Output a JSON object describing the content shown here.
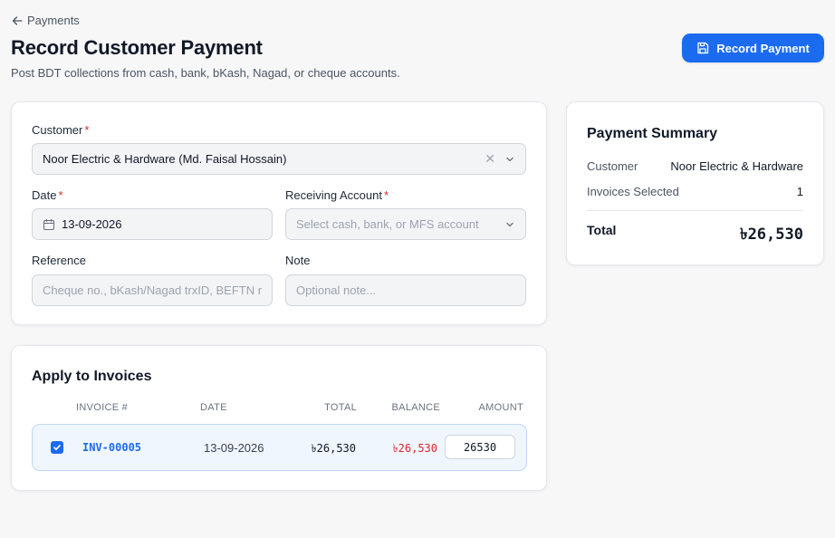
{
  "header": {
    "back_label": "Payments",
    "title": "Record Customer Payment",
    "subtitle": "Post BDT collections from cash, bank, bKash, Nagad, or cheque accounts.",
    "primary_button_label": "Record Payment"
  },
  "form": {
    "customer_label": "Customer",
    "customer_value": "Noor Electric & Hardware (Md. Faisal Hossain)",
    "date_label": "Date",
    "date_value": "13-09-2026",
    "account_label": "Receiving Account",
    "account_placeholder": "Select cash, bank, or MFS account",
    "reference_label": "Reference",
    "reference_placeholder": "Cheque no., bKash/Nagad trxID, BEFTN ref",
    "note_label": "Note",
    "note_placeholder": "Optional note...",
    "required_mark": "*"
  },
  "summary": {
    "title": "Payment Summary",
    "customer_label": "Customer",
    "customer_value": "Noor Electric & Hardware",
    "invoices_label": "Invoices Selected",
    "invoices_value": "1",
    "total_label": "Total",
    "total_value": "৳26,530"
  },
  "invoices": {
    "title": "Apply to Invoices",
    "columns": [
      "INVOICE #",
      "DATE",
      "TOTAL",
      "BALANCE",
      "AMOUNT"
    ],
    "rows": [
      {
        "checked": true,
        "invoice_no": "INV-00005",
        "date": "13-09-2026",
        "total": "৳26,530",
        "balance": "৳26,530",
        "amount": "26530"
      }
    ]
  },
  "colors": {
    "accent": "#1a6bf0",
    "danger": "#dc2626"
  },
  "icons": [
    "arrow-left-icon",
    "save-icon",
    "close-icon",
    "chevron-down-icon",
    "calendar-icon",
    "check-icon"
  ]
}
